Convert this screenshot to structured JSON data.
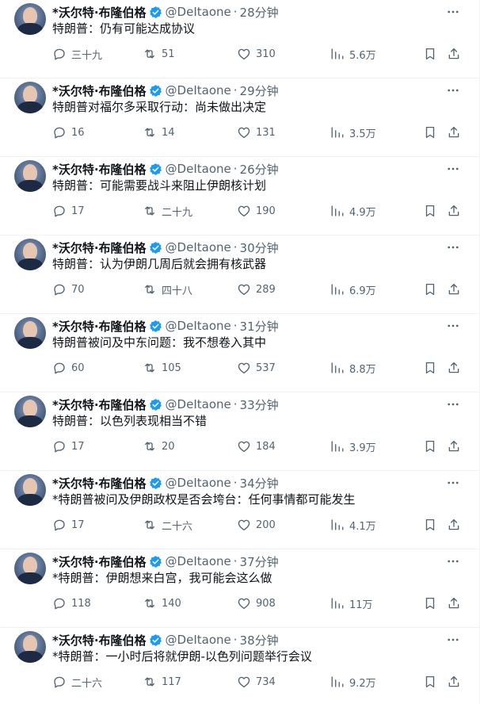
{
  "author": {
    "name": "*沃尔特·布隆伯格",
    "handle": "@DeItaone",
    "separator": "·"
  },
  "colors": {
    "verified": "#1d9bf0",
    "secondary_text": "#536471",
    "primary_text": "#0f1419",
    "divider": "#eff3f4"
  },
  "icons": {
    "more": "more-icon",
    "reply": "reply-icon",
    "retweet": "retweet-icon",
    "like": "heart-icon",
    "views": "views-icon",
    "bookmark": "bookmark-icon",
    "share": "share-icon"
  },
  "tweets": [
    {
      "time": "28分钟",
      "text": "特朗普：仍有可能达成协议",
      "replies": "三十九",
      "retweets": "51",
      "likes": "310",
      "views": "5.6万"
    },
    {
      "time": "29分钟",
      "text": "特朗普对福尔多采取行动：尚未做出决定",
      "replies": "16",
      "retweets": "14",
      "likes": "131",
      "views": "3.5万"
    },
    {
      "time": "26分钟",
      "text": "特朗普：可能需要战斗来阻止伊朗核计划",
      "replies": "17",
      "retweets": "二十九",
      "likes": "190",
      "views": "4.9万"
    },
    {
      "time": "30分钟",
      "text": "特朗普：认为伊朗几周后就会拥有核武器",
      "replies": "70",
      "retweets": "四十八",
      "likes": "289",
      "views": "6.9万"
    },
    {
      "time": "31分钟",
      "text": "特朗普被问及中东问题：我不想卷入其中",
      "replies": "60",
      "retweets": "105",
      "likes": "537",
      "views": "8.8万"
    },
    {
      "time": "33分钟",
      "text": "特朗普：以色列表现相当不错",
      "replies": "17",
      "retweets": "20",
      "likes": "184",
      "views": "3.9万"
    },
    {
      "time": "34分钟",
      "text": "*特朗普被问及伊朗政权是否会垮台：任何事情都可能发生",
      "replies": "17",
      "retweets": "二十六",
      "likes": "200",
      "views": "4.1万"
    },
    {
      "time": "37分钟",
      "text": "*特朗普：伊朗想来白宫，我可能会这么做",
      "replies": "118",
      "retweets": "140",
      "likes": "908",
      "views": "11万"
    },
    {
      "time": "38分钟",
      "text": "*特朗普：一小时后将就伊朗-以色列问题举行会议",
      "replies": "二十六",
      "retweets": "117",
      "likes": "734",
      "views": "9.2万"
    }
  ]
}
